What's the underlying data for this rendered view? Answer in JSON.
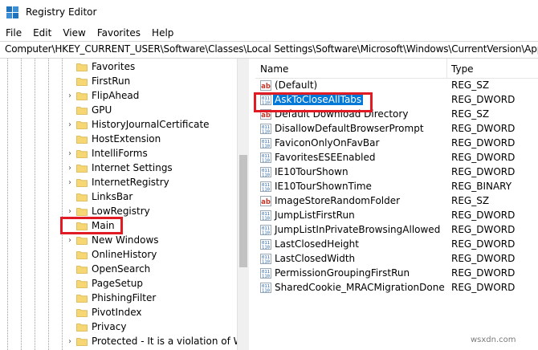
{
  "window": {
    "title": "Registry Editor",
    "icon": "registry-editor-icon"
  },
  "menu": [
    "File",
    "Edit",
    "View",
    "Favorites",
    "Help"
  ],
  "address": "Computer\\HKEY_CURRENT_USER\\Software\\Classes\\Local Settings\\Software\\Microsoft\\Windows\\CurrentVersion\\AppContain",
  "tree": {
    "items": [
      {
        "label": "Favorites",
        "expandable": false,
        "highlighted": false
      },
      {
        "label": "FirstRun",
        "expandable": false,
        "highlighted": false
      },
      {
        "label": "FlipAhead",
        "expandable": true,
        "highlighted": false
      },
      {
        "label": "GPU",
        "expandable": false,
        "highlighted": false
      },
      {
        "label": "HistoryJournalCertificate",
        "expandable": true,
        "highlighted": false
      },
      {
        "label": "HostExtension",
        "expandable": false,
        "highlighted": false
      },
      {
        "label": "IntelliForms",
        "expandable": true,
        "highlighted": false
      },
      {
        "label": "Internet Settings",
        "expandable": true,
        "highlighted": false
      },
      {
        "label": "InternetRegistry",
        "expandable": true,
        "highlighted": false
      },
      {
        "label": "LinksBar",
        "expandable": false,
        "highlighted": false
      },
      {
        "label": "LowRegistry",
        "expandable": true,
        "highlighted": false
      },
      {
        "label": "Main",
        "expandable": false,
        "highlighted": true
      },
      {
        "label": "New Windows",
        "expandable": true,
        "highlighted": false
      },
      {
        "label": "OnlineHistory",
        "expandable": false,
        "highlighted": false
      },
      {
        "label": "OpenSearch",
        "expandable": false,
        "highlighted": false
      },
      {
        "label": "PageSetup",
        "expandable": false,
        "highlighted": false
      },
      {
        "label": "PhishingFilter",
        "expandable": false,
        "highlighted": false
      },
      {
        "label": "PivotIndex",
        "expandable": false,
        "highlighted": false
      },
      {
        "label": "Privacy",
        "expandable": false,
        "highlighted": false
      },
      {
        "label": "Protected - It is a violation of Wind",
        "expandable": true,
        "highlighted": false
      }
    ]
  },
  "values": {
    "columns": {
      "name": "Name",
      "type": "Type"
    },
    "rows": [
      {
        "name": "(Default)",
        "type": "REG_SZ",
        "kind": "string",
        "selected": false,
        "highlighted": false
      },
      {
        "name": "AskToCloseAllTabs",
        "type": "REG_DWORD",
        "kind": "binary",
        "selected": true,
        "highlighted": true
      },
      {
        "name": "Default Download Directory",
        "type": "REG_SZ",
        "kind": "string",
        "selected": false,
        "highlighted": false
      },
      {
        "name": "DisallowDefaultBrowserPrompt",
        "type": "REG_DWORD",
        "kind": "binary",
        "selected": false,
        "highlighted": false
      },
      {
        "name": "FaviconOnlyOnFavBar",
        "type": "REG_DWORD",
        "kind": "binary",
        "selected": false,
        "highlighted": false
      },
      {
        "name": "FavoritesESEEnabled",
        "type": "REG_DWORD",
        "kind": "binary",
        "selected": false,
        "highlighted": false
      },
      {
        "name": "IE10TourShown",
        "type": "REG_DWORD",
        "kind": "binary",
        "selected": false,
        "highlighted": false
      },
      {
        "name": "IE10TourShownTime",
        "type": "REG_BINARY",
        "kind": "binary",
        "selected": false,
        "highlighted": false
      },
      {
        "name": "ImageStoreRandomFolder",
        "type": "REG_SZ",
        "kind": "string",
        "selected": false,
        "highlighted": false
      },
      {
        "name": "JumpListFirstRun",
        "type": "REG_DWORD",
        "kind": "binary",
        "selected": false,
        "highlighted": false
      },
      {
        "name": "JumpListInPrivateBrowsingAllowed",
        "type": "REG_DWORD",
        "kind": "binary",
        "selected": false,
        "highlighted": false
      },
      {
        "name": "LastClosedHeight",
        "type": "REG_DWORD",
        "kind": "binary",
        "selected": false,
        "highlighted": false
      },
      {
        "name": "LastClosedWidth",
        "type": "REG_DWORD",
        "kind": "binary",
        "selected": false,
        "highlighted": false
      },
      {
        "name": "PermissionGroupingFirstRun",
        "type": "REG_DWORD",
        "kind": "binary",
        "selected": false,
        "highlighted": false
      },
      {
        "name": "SharedCookie_MRACMigrationDone",
        "type": "REG_DWORD",
        "kind": "binary",
        "selected": false,
        "highlighted": false
      }
    ]
  },
  "colors": {
    "selection": "#0078d7",
    "highlight_box": "#e01b24",
    "folder": "#f7d774"
  },
  "watermark": "wsxdn.com"
}
